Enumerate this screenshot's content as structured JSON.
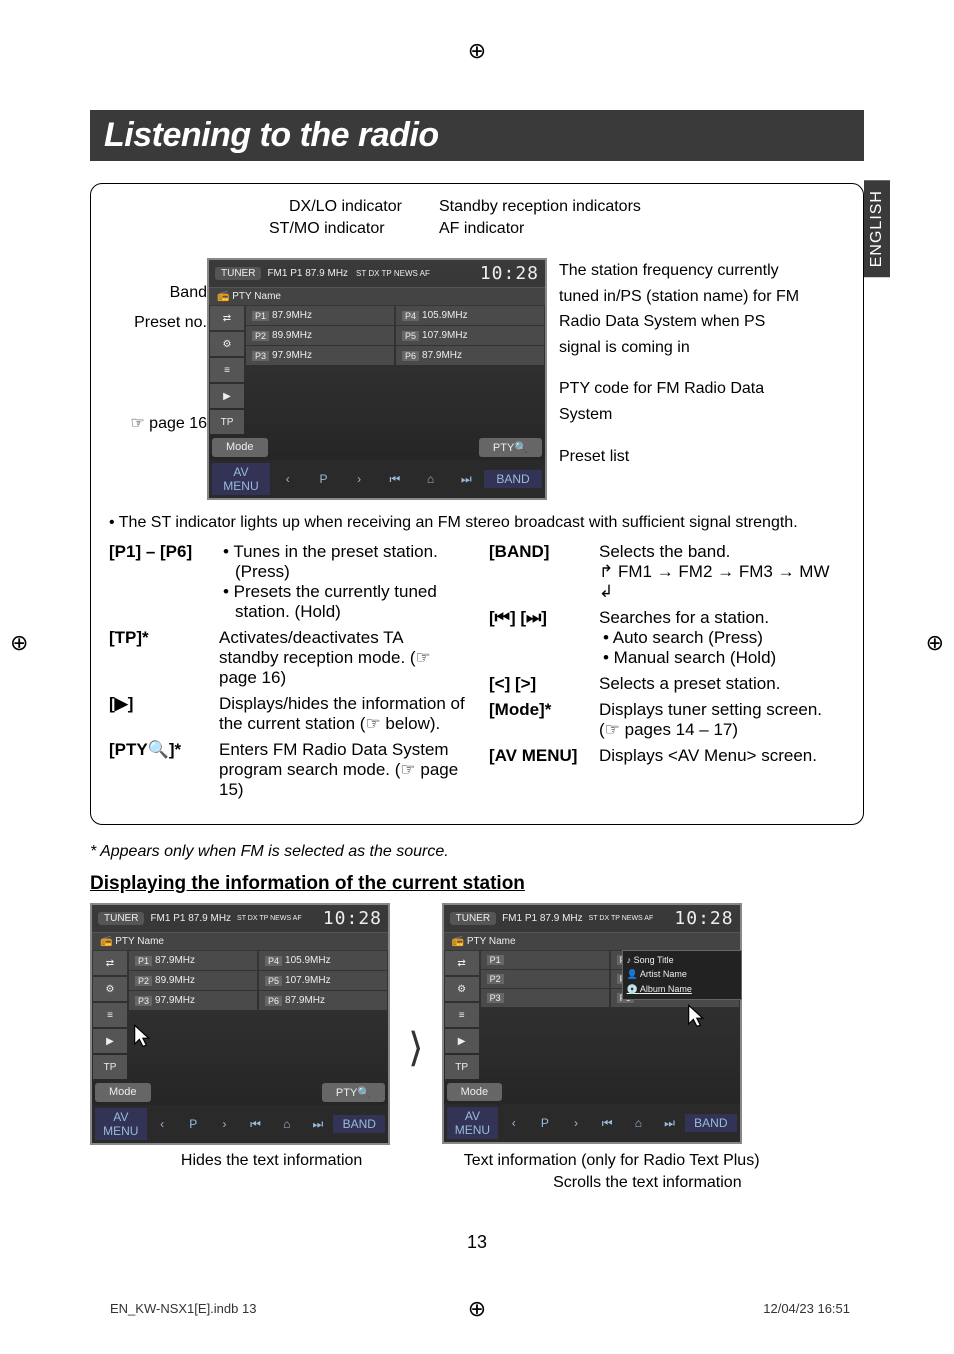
{
  "registration": "⊕",
  "side_tab": "ENGLISH",
  "title": "Listening to the radio",
  "callouts": {
    "dxlo": "DX/LO indicator",
    "standby": "Standby reception indicators",
    "stmo": "ST/MO indicator",
    "af": "AF indicator",
    "band": "Band",
    "presetno": "Preset no.",
    "page16": "☞ page 16",
    "freq_desc": "The station frequency currently tuned in/PS (station name) for FM Radio Data System when PS signal is coming in",
    "pty_desc": "PTY code for FM Radio Data System",
    "preset_list": "Preset list"
  },
  "tuner": {
    "badge": "TUNER",
    "band_freq": "FM1  P1  87.9 MHz",
    "indicators": "ST  DX  TP  NEWS  AF",
    "time": "10:28",
    "pty_label": "PTY Name",
    "side": [
      "⇄",
      "⚙",
      "≡",
      "▶",
      "TP"
    ],
    "presets": [
      {
        "n": "P1",
        "f": "87.9MHz"
      },
      {
        "n": "P2",
        "f": "89.9MHz"
      },
      {
        "n": "P3",
        "f": "97.9MHz"
      },
      {
        "n": "P4",
        "f": "105.9MHz"
      },
      {
        "n": "P5",
        "f": "107.9MHz"
      },
      {
        "n": "P6",
        "f": "87.9MHz"
      }
    ],
    "mode": "Mode",
    "pty_btn": "PTY🔍",
    "avmenu": "AV MENU",
    "bandbtn": "BAND",
    "navicons": [
      "‹",
      "P",
      "›",
      "⏮",
      "⌂",
      "⏭"
    ]
  },
  "note_st": "The ST indicator lights up when receiving an FM stereo broadcast with sufficient signal strength.",
  "controls_left": [
    {
      "key": "[P1] – [P6]",
      "lines": [
        "• Tunes in the preset station. (Press)",
        "• Presets the currently tuned station. (Hold)"
      ]
    },
    {
      "key": "[TP]*",
      "lines": [
        "Activates/deactivates TA standby reception mode. (☞ page 16)"
      ]
    },
    {
      "key": "[▶]",
      "lines": [
        "Displays/hides the information of the current station (☞ below)."
      ]
    },
    {
      "key": "[PTY🔍]*",
      "lines": [
        "Enters FM Radio Data System program search mode. (☞ page 15)"
      ]
    }
  ],
  "controls_right": [
    {
      "key": "[BAND]",
      "lines": [
        "Selects the band.",
        "↱ FM1 → FM2 → FM3 → MW ↲"
      ]
    },
    {
      "key": "[⏮] [⏭]",
      "lines": [
        "Searches for a station.",
        "• Auto search (Press)",
        "• Manual search (Hold)"
      ]
    },
    {
      "key": "[<] [>]",
      "lines": [
        "Selects a preset station."
      ]
    },
    {
      "key": "[Mode]*",
      "lines": [
        "Displays tuner setting screen. (☞ pages 14 – 17)"
      ]
    },
    {
      "key": "[AV MENU]",
      "lines": [
        "Displays <AV Menu> screen."
      ]
    }
  ],
  "star_note": "*  Appears only when FM is selected as the source.",
  "subsection": "Displaying the information of the current station",
  "info_screen": {
    "song": "Song Title",
    "artist": "Artist Name",
    "album": "Album Name"
  },
  "captions": {
    "hides": "Hides the text information",
    "textinfo": "Text information (only for Radio Text Plus)",
    "scrolls": "Scrolls the text information"
  },
  "page_number": "13",
  "footer_left": "EN_KW-NSX1[E].indb   13",
  "footer_right": "12/04/23   16:51"
}
